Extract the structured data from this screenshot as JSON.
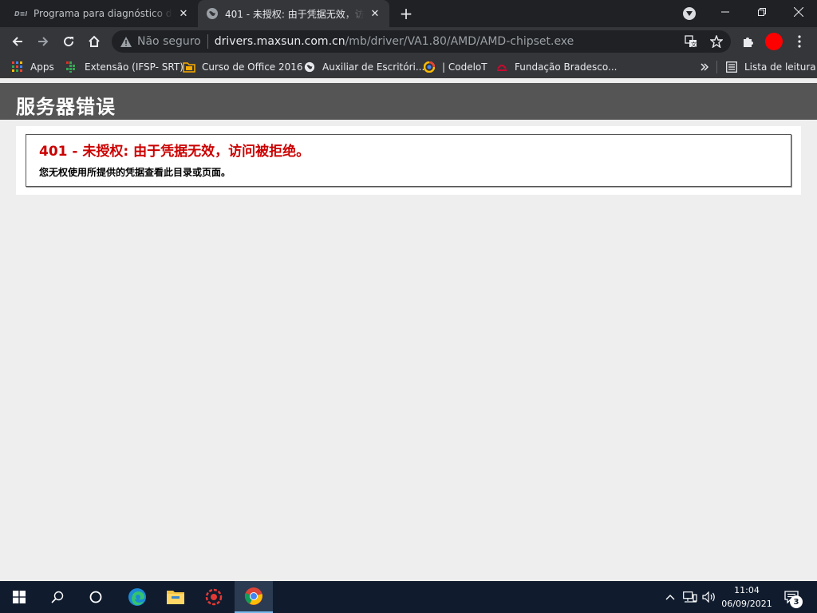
{
  "tabs": [
    {
      "title": "Programa para diagnóstico de ha",
      "icon": "dell-logo-icon"
    },
    {
      "title": "401 - 未授权: 由于凭据无效，访问",
      "icon": "globe-icon",
      "active": true
    }
  ],
  "omnibox": {
    "security_label": "Não seguro",
    "host": "drivers.maxsun.com.cn",
    "path": "/mb/driver/VA1.80/AMD/AMD-chipset.exe"
  },
  "bookmarks": [
    {
      "label": "Apps",
      "icon": "apps-grid-icon"
    },
    {
      "label": "Extensão (IFSP- SRT)",
      "icon": "ifsp-icon"
    },
    {
      "label": "Curso de Office 2016",
      "icon": "folder-icon"
    },
    {
      "label": "Auxiliar de Escritóri...",
      "icon": "globe-icon"
    },
    {
      "label": "| CodeloT",
      "icon": "codeiot-icon"
    },
    {
      "label": "Fundação Bradesco...",
      "icon": "bradesco-icon"
    }
  ],
  "reading_list": {
    "label": "Lista de leitura"
  },
  "page": {
    "header": "服务器错误",
    "error_title": "401 - 未授权: 由于凭据无效，访问被拒绝。",
    "error_desc": "您无权使用所提供的凭据查看此目录或页面。"
  },
  "taskbar": {
    "time": "11:04",
    "date": "06/09/2021",
    "notifications": "3"
  },
  "colors": {
    "error_red": "#cc0000",
    "header_gray": "#555555",
    "avatar_red": "#ff0000"
  }
}
